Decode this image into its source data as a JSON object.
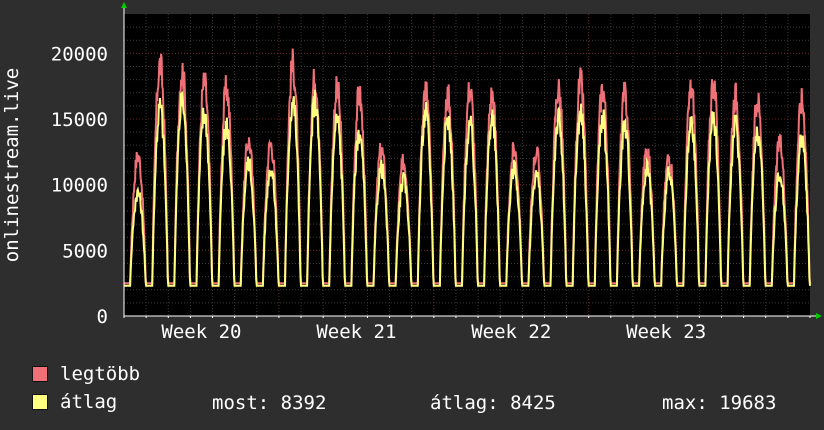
{
  "chart_data": {
    "type": "line",
    "ylabel": "onlinestream.live",
    "ylim": [
      0,
      23000
    ],
    "y_ticks": [
      "0",
      "5000",
      "10000",
      "15000",
      "20000"
    ],
    "y_tick_values": [
      0,
      5000,
      10000,
      15000,
      20000
    ],
    "x_labels": [
      "Week 20",
      "Week 21",
      "Week 22",
      "Week 23"
    ],
    "grid": true,
    "legend_placement": "bottom",
    "days": 31,
    "week_label_day": [
      3.5,
      10.5,
      17.5,
      24.5
    ],
    "series": [
      {
        "name": "legtöbb",
        "color": "#f07078",
        "daily_peaks": [
          13000,
          20500,
          20000,
          19000,
          18500,
          14200,
          14000,
          20500,
          19500,
          18500,
          18000,
          13500,
          12500,
          18500,
          18000,
          18500,
          18000,
          13500,
          13300,
          18500,
          19000,
          18500,
          18000,
          13500,
          13000,
          18500,
          19000,
          18000,
          17500,
          14000,
          17500
        ],
        "minimum": 2500
      },
      {
        "name": "átlag",
        "color": "#ffff80",
        "daily_peaks": [
          10000,
          17000,
          17500,
          16500,
          15500,
          12500,
          12000,
          17500,
          17500,
          16000,
          15000,
          12000,
          11000,
          16500,
          16000,
          15500,
          16000,
          12000,
          11500,
          16000,
          16500,
          16000,
          15500,
          12000,
          11500,
          15500,
          16000,
          15500,
          15000,
          11500,
          14500
        ],
        "minimum": 2300
      }
    ]
  },
  "legend": [
    {
      "label": "legtöbb",
      "color": "#f07078"
    },
    {
      "label": "átlag",
      "color": "#ffff80"
    }
  ],
  "stats": {
    "most": "most: 8392",
    "atlag": "átlag: 8425",
    "max": "max: 19683"
  }
}
